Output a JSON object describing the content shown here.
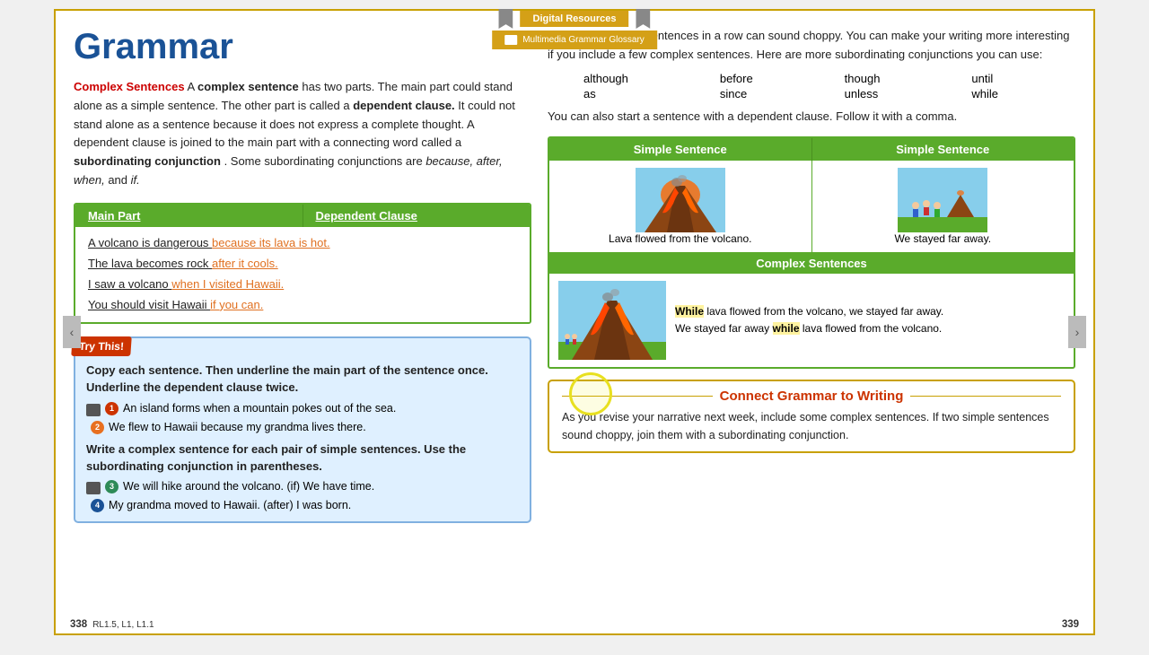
{
  "page": {
    "title": "Grammar",
    "page_numbers": {
      "left": "338",
      "right": "339"
    },
    "standards": "RL1.5, L1, L1.1"
  },
  "toolbar": {
    "digital_resources_label": "Digital Resources",
    "multimedia_grammar_glossary": "Multimedia Grammar Glossary"
  },
  "left_column": {
    "intro": {
      "label": "Complex Sentences",
      "text1": "A",
      "bold1": "complex sentence",
      "text2": "has two parts. The main part could stand alone as a simple sentence. The other part is called a",
      "bold2": "dependent clause.",
      "text3": "It could not stand alone as a sentence because it does not express a complete thought. A dependent clause is joined to the main part with a connecting word called a",
      "bold3": "subordinating conjunction",
      "text4": ". Some subordinating conjunctions are",
      "italic1": "because, after, when,",
      "text5": "and",
      "italic2": "if."
    },
    "table": {
      "col1": "Main Part",
      "col2": "Dependent Clause",
      "rows": [
        {
          "main": "A volcano is dangerous",
          "dep": "because its lava is hot."
        },
        {
          "main": "The lava becomes rock",
          "dep": "after it cools."
        },
        {
          "main": "I saw a volcano",
          "dep": "when I visited Hawaii."
        },
        {
          "main": "You should visit Hawaii",
          "dep": "if you can."
        }
      ]
    },
    "try_this": {
      "label": "Try This!",
      "instruction": "Copy each sentence. Then underline the main part of the sentence once. Underline the dependent clause twice.",
      "exercises": [
        {
          "num": "1",
          "text": "An island forms when a mountain pokes out of the sea."
        },
        {
          "num": "2",
          "text": "We flew to Hawaii because my grandma lives there."
        }
      ],
      "write_instruction": "Write a complex sentence for each pair of simple sentences. Use the subordinating conjunction in parentheses.",
      "write_exercises": [
        {
          "num": "3",
          "text": "We will hike around the volcano. (if) We have time."
        },
        {
          "num": "4",
          "text": "My grandma moved to Hawaii. (after) I was born."
        }
      ]
    }
  },
  "right_column": {
    "intro_text": "Many short simple sentences in a row can sound choppy. You can make your writing more interesting if you include a few complex sentences. Here are more subordinating conjunctions you can use:",
    "conjunctions": [
      "although",
      "before",
      "though",
      "until",
      "as",
      "since",
      "unless",
      "while"
    ],
    "start_text": "You can also start a sentence with a dependent clause. Follow it with a comma.",
    "table": {
      "col1": "Simple Sentence",
      "col2": "Simple Sentence",
      "complex_header": "Complex Sentences",
      "row1_text": "Lava flowed from the volcano.",
      "row2_text": "We stayed far away.",
      "complex_text1": "While lava flowed from the volcano, we stayed far away.",
      "complex_text2": "We stayed far away while lava flowed from the volcano."
    },
    "connect_grammar": {
      "title": "Connect Grammar to Writing",
      "text": "As you revise your narrative next week, include some complex sentences. If two simple sentences sound choppy, join them with a subordinating conjunction."
    }
  }
}
